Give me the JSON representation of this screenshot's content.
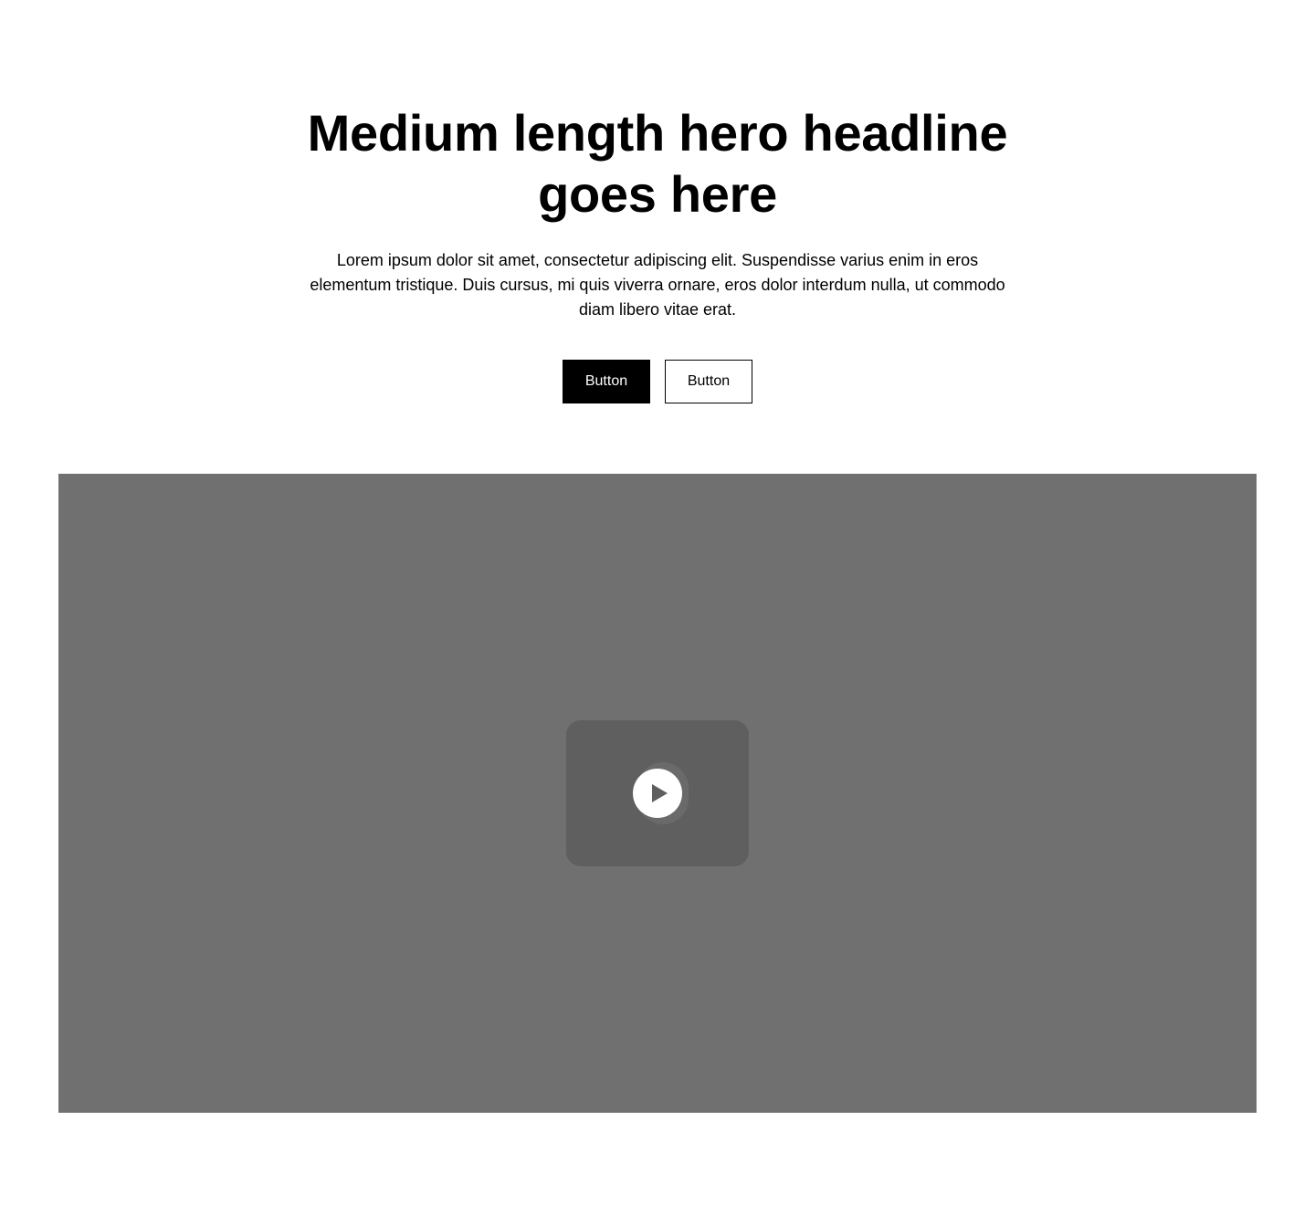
{
  "hero": {
    "title": "Medium length hero headline goes here",
    "subtitle": "Lorem ipsum dolor sit amet, consectetur adipiscing elit. Suspendisse varius enim in eros elementum tristique. Duis cursus, mi quis viverra ornare, eros dolor interdum nulla, ut commodo diam libero vitae erat.",
    "primary_button": "Button",
    "secondary_button": "Button"
  },
  "video": {
    "icon": "play-icon"
  },
  "colors": {
    "primary_button_bg": "#000000",
    "video_background": "#707070",
    "video_thumbnail": "#5f5f5f"
  }
}
